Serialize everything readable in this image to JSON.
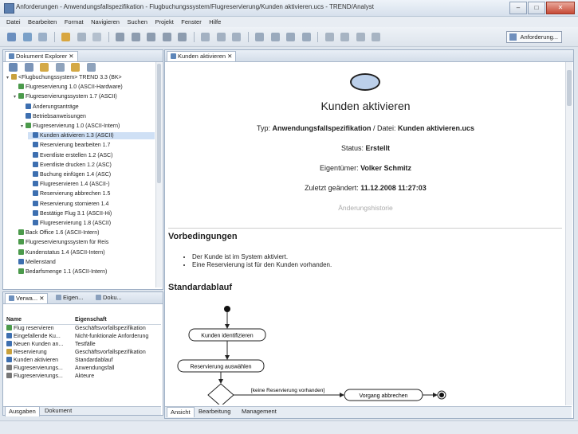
{
  "window": {
    "title": "Anforderungen - Anwendungsfallspezifikation - Flugbuchungssystem/Flugreservierung/Kunden aktivieren.ucs - TREND/Analyst",
    "min": "–",
    "max": "□",
    "close": "✕"
  },
  "menu": [
    "Datei",
    "Bearbeiten",
    "Format",
    "Navigieren",
    "Suchen",
    "Projekt",
    "Fenster",
    "Hilfe"
  ],
  "toolbar": {
    "perspective_label": "Anforderung..."
  },
  "explorer": {
    "tab_label": "Dokument Explorer",
    "tree": [
      {
        "label": "<Flugbuchungssystem> TREND 3.3 (BK>",
        "level": 0,
        "color": "#c9a13c",
        "twisty": "▾"
      },
      {
        "label": "Flugreservierung 1.0 (ASCII-Hardware)",
        "level": 1,
        "color": "#4b9a4b",
        "twisty": ""
      },
      {
        "label": "Flugreservierungssystem 1.7 (ASCII)",
        "level": 1,
        "color": "#4b9a4b",
        "twisty": "▾"
      },
      {
        "label": "Änderungsanträge",
        "level": 2,
        "color": "#3d6fb0",
        "twisty": ""
      },
      {
        "label": "Betriebsanweisungen",
        "level": 2,
        "color": "#3d6fb0",
        "twisty": ""
      },
      {
        "label": "Flugreservierung 1.0 (ASCII-Intern)",
        "level": 2,
        "color": "#4b9a4b",
        "twisty": "▾"
      },
      {
        "label": "Kunden aktivieren 1.3 (ASCII)",
        "level": 3,
        "color": "#3d6fb0",
        "twisty": "",
        "selected": true
      },
      {
        "label": "Reservierung bearbeiten 1.7",
        "level": 3,
        "color": "#3d6fb0",
        "twisty": ""
      },
      {
        "label": "Eventliste erstellen 1.2 (ASC)",
        "level": 3,
        "color": "#3d6fb0",
        "twisty": ""
      },
      {
        "label": "Eventliste drucken 1.2 (ASC)",
        "level": 3,
        "color": "#3d6fb0",
        "twisty": ""
      },
      {
        "label": "Buchung einfügen 1.4 (ASC)",
        "level": 3,
        "color": "#3d6fb0",
        "twisty": ""
      },
      {
        "label": "Flugreservieren 1.4 (ASCII-)",
        "level": 3,
        "color": "#3d6fb0",
        "twisty": ""
      },
      {
        "label": "Reservierung abbrechen 1.5",
        "level": 3,
        "color": "#3d6fb0",
        "twisty": ""
      },
      {
        "label": "Reservierung stornieren 1.4",
        "level": 3,
        "color": "#3d6fb0",
        "twisty": ""
      },
      {
        "label": "Bestätige Flug 3.1 (ASCII-Hi)",
        "level": 3,
        "color": "#3d6fb0",
        "twisty": ""
      },
      {
        "label": "Flugreservierung 1.8 (ASCII)",
        "level": 3,
        "color": "#3d6fb0",
        "twisty": ""
      },
      {
        "label": "Back Office 1.6 (ASCII-Intern)",
        "level": 1,
        "color": "#4b9a4b",
        "twisty": ""
      },
      {
        "label": "Flugreservierungssystem für Reis",
        "level": 1,
        "color": "#4b9a4b",
        "twisty": ""
      },
      {
        "label": "Kundenstatus 1.4 (ASCII-Intern)",
        "level": 1,
        "color": "#4b9a4b",
        "twisty": ""
      },
      {
        "label": "Meilenstand",
        "level": 1,
        "color": "#3d6fb0",
        "twisty": ""
      },
      {
        "label": "Bedarfsmenge 1.1 (ASCII-Intern)",
        "level": 1,
        "color": "#4b9a4b",
        "twisty": ""
      }
    ]
  },
  "props": {
    "tabs": [
      "Verwa...",
      "Eigen...",
      "Doku..."
    ],
    "col_name": "Name",
    "col_value": "Eigenschaft",
    "rows": [
      {
        "name": "Flug reservieren",
        "value": "Geschäftsvorfallspezifikation",
        "color": "#4b9a4b"
      },
      {
        "name": "Eingefallende Ku...",
        "value": "Nicht-funktionale Anforderung",
        "color": "#3d6fb0"
      },
      {
        "name": "Neuen Kunden an...",
        "value": "Testfälle",
        "color": "#3d6fb0"
      },
      {
        "name": "Reservierung",
        "value": "Geschäftsvorfallspezifikation",
        "color": "#c9a13c"
      },
      {
        "name": "Kunden aktivieren",
        "value": "Standardablauf",
        "color": "#3d6fb0"
      },
      {
        "name": "Flugreservierungs...",
        "value": "Anwendungsfall",
        "color": "#777777"
      },
      {
        "name": "Flugreservierungs...",
        "value": "Akteure",
        "color": "#777777"
      }
    ],
    "bottom_tabs": [
      "Ausgaben",
      "Dokument"
    ]
  },
  "editor": {
    "tab_label": "Kunden aktivieren",
    "title": "Kunden aktivieren",
    "type_prefix": "Typ:",
    "type_value": "Anwendungsfallspezifikation",
    "date_prefix": "/ Datei:",
    "date_value": "Kunden aktivieren.ucs",
    "status_prefix": "Status:",
    "status_value": "Erstellt",
    "owner_prefix": "Eigentümer:",
    "owner_value": "Volker Schmitz",
    "changed_prefix": "Zuletzt geändert:",
    "changed_value": "11.12.2008 11:27:03",
    "history": "Änderungshistorie",
    "preconditions_heading": "Vorbedingungen",
    "preconditions": [
      "Der Kunde ist im System aktiviert.",
      "Eine Reservierung ist für den Kunden vorhanden."
    ],
    "standard_heading": "Standardablauf",
    "diagram": {
      "action1": "Kunden identifizieren",
      "action2": "Reservierung auswählen",
      "guard": "[keine Reservierung vorhanden]",
      "action3": "Vorgang abbrechen"
    },
    "bottom_tabs": [
      "Ansicht",
      "Bearbeitung",
      "Management"
    ]
  }
}
